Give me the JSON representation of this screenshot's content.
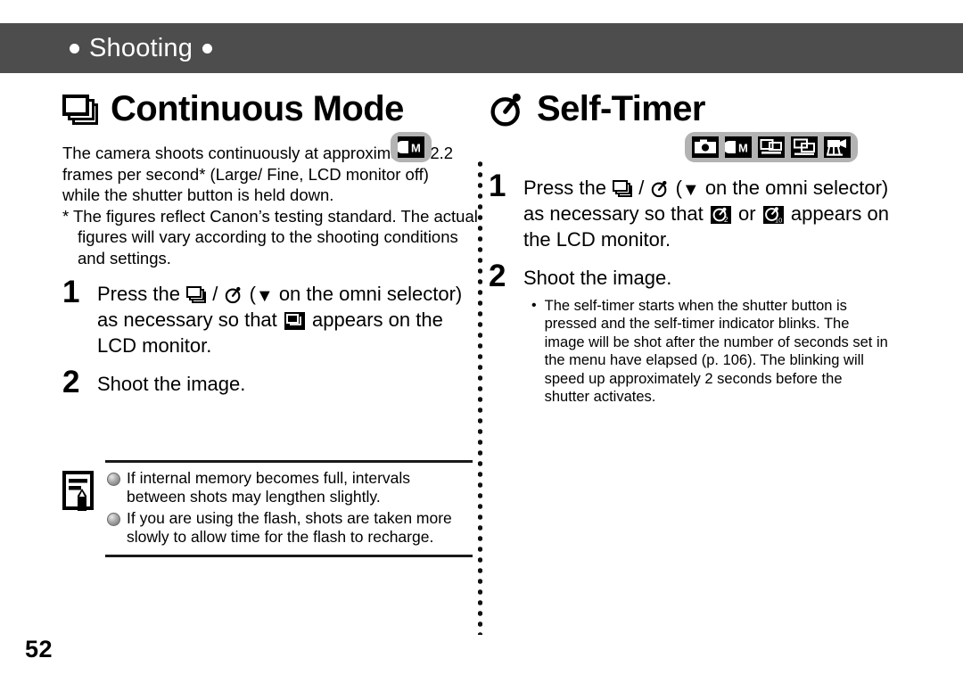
{
  "banner": {
    "label": "Shooting",
    "bg_color": "#4d4d4d",
    "text_color": "#ffffff",
    "dot_left": "●",
    "dot_right": "●"
  },
  "left_column": {
    "title": "Continuous Mode",
    "title_icon": "continuous-burst-icon",
    "mode_badges": [
      {
        "name": "stitch-assist-cm-mode-icon",
        "label": "CM"
      }
    ],
    "intro_paragraph": "The camera shoots continuously at approximately 2.2 frames per second* (Large/ Fine, LCD monitor off) while the shutter button is held down.",
    "footnote": "* The figures reflect Canon’s testing standard. The actual figures will vary according to the shooting conditions and settings.",
    "steps": [
      {
        "number": "1",
        "text_before": "Press the",
        "text_mid": "/",
        "text_after_icons": "(",
        "text_omni": "on the omni selector) as necessary so that",
        "text_end": "appears on the LCD monitor."
      },
      {
        "number": "2",
        "text": "Shoot the image."
      }
    ],
    "note": {
      "icon": "memo-note-icon",
      "items": [
        "If internal memory becomes full, intervals between shots may lengthen slightly.",
        "If you are using the flash, shots are taken more slowly to allow time for the flash to recharge."
      ]
    }
  },
  "right_column": {
    "title": "Self-Timer",
    "title_icon": "self-timer-stopwatch-icon",
    "mode_badges": [
      {
        "name": "auto-camera-mode-icon",
        "label": ""
      },
      {
        "name": "stitch-assist-cm-mode-icon",
        "label": "CM"
      },
      {
        "name": "stitch-assist-horizontal-mode-icon",
        "label": ""
      },
      {
        "name": "stitch-assist-vertical-mode-icon",
        "label": ""
      },
      {
        "name": "movie-mode-icon",
        "label": ""
      }
    ],
    "steps": [
      {
        "number": "1",
        "text_before": "Press the",
        "text_mid": "/",
        "text_after_icons": "(",
        "text_omni": "on the omni selector) as necessary so that",
        "text_or": "or",
        "text_end": "appears on the LCD monitor."
      },
      {
        "number": "2",
        "text": "Shoot the image."
      }
    ],
    "bullets": [
      {
        "marker": "•",
        "text": "The self-timer starts when the shutter button is pressed and the self-timer indicator blinks. The image will be shot after the number of seconds set in the menu have elapsed (p. 106). The blinking will speed up approximately 2 seconds before the shutter activates."
      }
    ]
  },
  "footer": {
    "page_number": "52"
  },
  "icons": {
    "down_triangle": "▼",
    "self_timer_2sec_label": "2",
    "self_timer_10sec_label": "10"
  },
  "colors": {
    "badge_bg": "#b3b3b3",
    "banner_bg": "#4d4d4d",
    "ink": "#000000"
  }
}
